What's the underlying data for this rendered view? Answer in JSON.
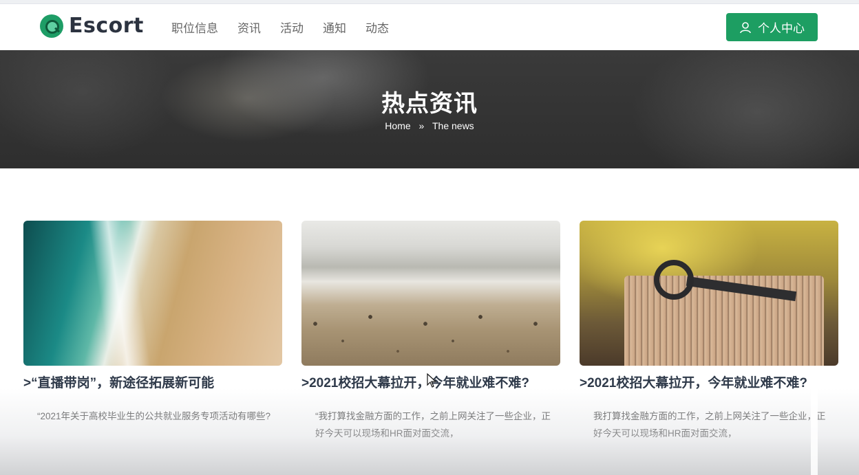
{
  "header": {
    "logo_text": "Escort",
    "nav": [
      "职位信息",
      "资讯",
      "活动",
      "通知",
      "动态"
    ],
    "user_button": "个人中心"
  },
  "banner": {
    "title": "热点资讯",
    "breadcrumb": {
      "home": "Home",
      "separator": "»",
      "current": "The news"
    }
  },
  "cards": [
    {
      "title": ">“直播带岗”，新途径拓展新可能",
      "excerpt": "“2021年关于高校毕业生的公共就业服务专项活动有哪些?",
      "image": "ocean-shore-aerial"
    },
    {
      "title": ">2021校招大幕拉开，今年就业难不难?",
      "excerpt": "“我打算找金融方面的工作，之前上网关注了一些企业，正好今天可以现场和HR面对面交流，",
      "image": "pebble-beach"
    },
    {
      "title": ">2021校招大幕拉开，今年就业难不难?",
      "excerpt": "我打算找金融方面的工作，之前上网关注了一些企业，正好今天可以现场和HR面对面交流，",
      "image": "key-on-book"
    }
  ],
  "colors": {
    "accent": "#1d9e62",
    "title": "#2f3a4a"
  }
}
